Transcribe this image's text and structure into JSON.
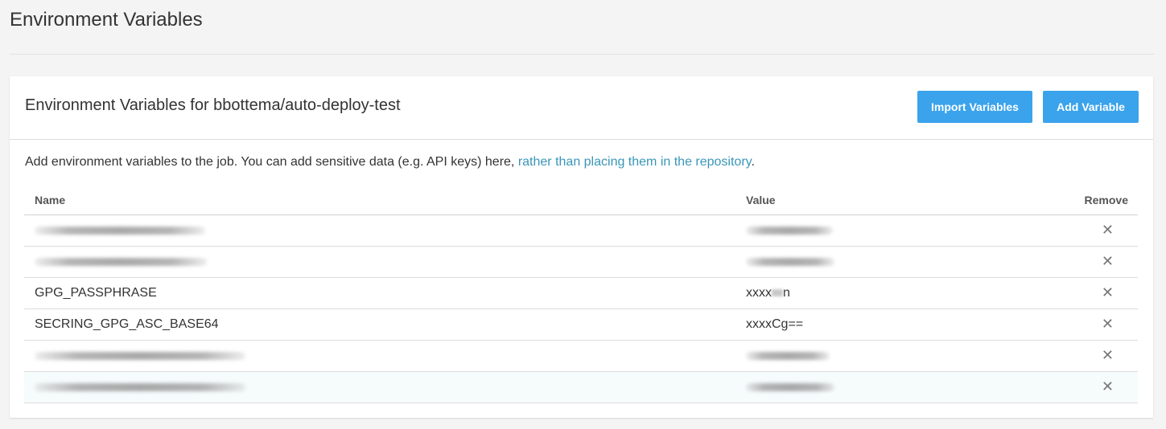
{
  "page": {
    "title": "Environment Variables"
  },
  "card": {
    "title": "Environment Variables for bbottema/auto-deploy-test",
    "import_label": "Import Variables",
    "add_label": "Add Variable",
    "description_text": "Add environment variables to the job. You can add sensitive data (e.g. API keys) here, ",
    "description_link": "rather than placing them in the repository",
    "description_end": "."
  },
  "table": {
    "headers": {
      "name": "Name",
      "value": "Value",
      "remove": "Remove"
    },
    "rows": [
      {
        "name": "",
        "value": "",
        "redacted": true
      },
      {
        "name": "",
        "value": "",
        "redacted": true
      },
      {
        "name": "GPG_PASSPHRASE",
        "value_prefix": "xxxx",
        "value_suffix": "n",
        "redacted": false
      },
      {
        "name": "SECRING_GPG_ASC_BASE64",
        "value": "xxxxCg==",
        "redacted": false
      },
      {
        "name": "",
        "value": "",
        "redacted": true
      },
      {
        "name": "",
        "value": "",
        "redacted": true
      }
    ],
    "remove_icon": "close-icon",
    "remove_glyph": "✕"
  }
}
